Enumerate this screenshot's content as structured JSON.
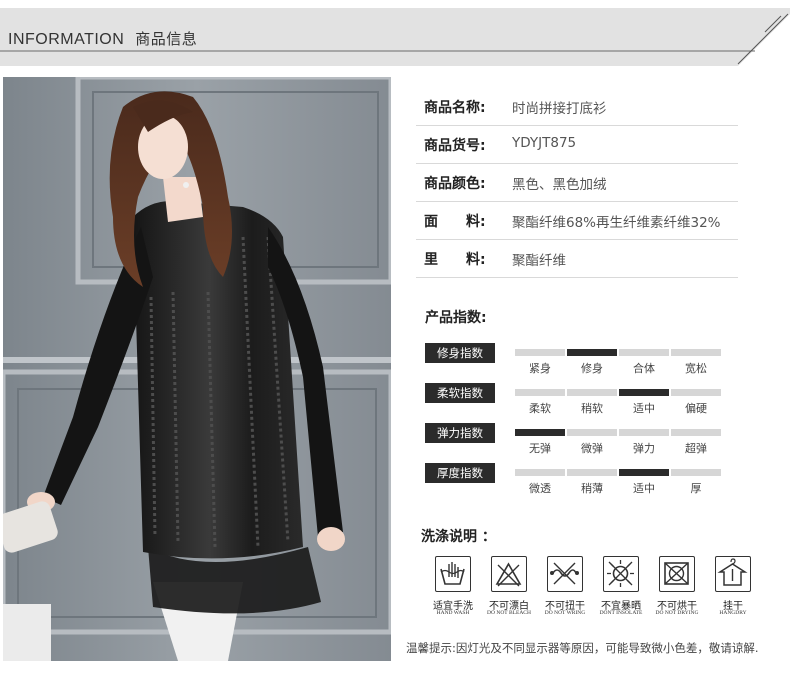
{
  "header": {
    "title_en": "INFORMATION",
    "title_cn": "商品信息"
  },
  "photo": {
    "description_icon": "product-model-photo"
  },
  "info": [
    {
      "label": "商品名称:",
      "value": "时尚拼接打底衫"
    },
    {
      "label": "商品货号:",
      "value": "YDYJT875"
    },
    {
      "label": "商品颜色:",
      "value": "黑色、黑色加绒"
    },
    {
      "label": "面　　料:",
      "value": "聚酯纤维68%再生纤维素纤维32%"
    },
    {
      "label": "里　　料:",
      "value": "聚酯纤维"
    }
  ],
  "indices": {
    "title": "产品指数:",
    "rows": [
      {
        "name": "修身指数",
        "options": [
          "紧身",
          "修身",
          "合体",
          "宽松"
        ],
        "selected": 1
      },
      {
        "name": "柔软指数",
        "options": [
          "柔软",
          "稍软",
          "适中",
          "偏硬"
        ],
        "selected": 2
      },
      {
        "name": "弹力指数",
        "options": [
          "无弹",
          "微弹",
          "弹力",
          "超弹"
        ],
        "selected": 0
      },
      {
        "name": "厚度指数",
        "options": [
          "微透",
          "稍薄",
          "适中",
          "厚"
        ],
        "selected": 2
      }
    ]
  },
  "wash": {
    "title": "洗涤说明 ：",
    "items": [
      {
        "cn": "适宜手洗",
        "en": "HAND WASH",
        "icon": "hand-wash-icon"
      },
      {
        "cn": "不可漂白",
        "en": "DO NOT BLEACH",
        "icon": "no-bleach-icon"
      },
      {
        "cn": "不可扭干",
        "en": "DO NOT WRING",
        "icon": "no-wring-icon"
      },
      {
        "cn": "不宜暴晒",
        "en": "DONT INSOLATE",
        "icon": "no-sun-icon"
      },
      {
        "cn": "不可烘干",
        "en": "DO NOT DRYING",
        "icon": "no-tumble-dry-icon"
      },
      {
        "cn": "挂干",
        "en": "HANGDRY",
        "icon": "hang-dry-icon"
      }
    ]
  },
  "notice": "温馨提示:因灯光及不同显示器等原因，可能导致微小色差，敬请谅解.",
  "colors": {
    "dark": "#2b2b2b",
    "light_seg": "#d6d6d6",
    "banner_bg": "#e3e3e3"
  }
}
